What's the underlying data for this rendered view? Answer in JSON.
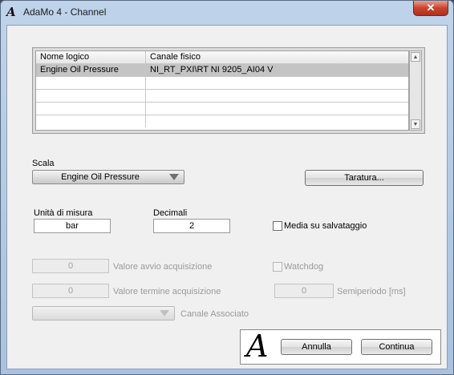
{
  "window": {
    "title": "AdaMo 4 - Channel",
    "close_glyph": "✕",
    "app_icon": "A"
  },
  "table": {
    "headers": [
      "Nome logico",
      "Canale fisico"
    ],
    "rows": [
      [
        "Engine Oil Pressure",
        "NI_RT_PXI\\RT NI 9205_AI04 V"
      ],
      [
        "",
        ""
      ],
      [
        "",
        ""
      ],
      [
        "",
        ""
      ],
      [
        "",
        ""
      ]
    ],
    "scroll_up": "▲",
    "scroll_down": "▼"
  },
  "scala": {
    "label": "Scala",
    "value": "Engine Oil Pressure"
  },
  "taratura_button": "Taratura...",
  "unita": {
    "label": "Unità di misura",
    "value": "bar"
  },
  "decimali": {
    "label": "Decimali",
    "value": "2"
  },
  "media": {
    "label": "Media su salvataggio",
    "checked": false
  },
  "avvio": {
    "value": "0",
    "label": "Valore avvio acquisizione"
  },
  "termine": {
    "value": "0",
    "label": "Valore termine acquisizione"
  },
  "watchdog": {
    "label": "Watchdog",
    "checked": false
  },
  "semiperiodo": {
    "value": "0",
    "label": "Semiperiodo [ms]"
  },
  "canale_associato": {
    "label": "Canale Associato",
    "value": ""
  },
  "logo_mark": "A",
  "buttons": {
    "annulla": "Annulla",
    "continua": "Continua"
  }
}
